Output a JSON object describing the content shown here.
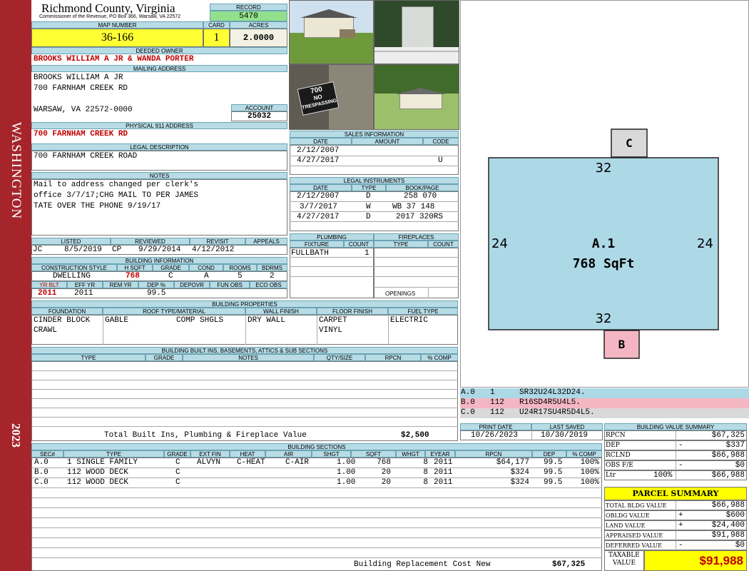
{
  "sidebar": {
    "district": "WASHINGTON",
    "year": "2023"
  },
  "header": {
    "county": "Richmond County, Virginia",
    "commissioner": "Commissioner of the Revenue, PO Box 366, Warsaw, VA 22572",
    "record_label": "RECORD",
    "record": "5470",
    "map_label": "MAP NUMBER",
    "map": "36-166",
    "card_label": "CARD",
    "card": "1",
    "acres_label": "ACRES",
    "acres": "2.0000"
  },
  "owner": {
    "deeded_label": "DEEDED OWNER",
    "deeded": "BROOKS WILLIAM A JR & WANDA PORTER",
    "mailing_label": "MAILING ADDRESS",
    "mail1": "BROOKS WILLIAM A JR",
    "mail2": "700 FARNHAM CREEK RD",
    "mail3": "WARSAW, VA 22572-0000",
    "account_label": "ACCOUNT",
    "account": "25032",
    "physical_label": "PHYSICAL 911 ADDRESS",
    "physical": "700 FARNHAM CREEK RD",
    "legal_label": "LEGAL DESCRIPTION",
    "legal": "700 FARNHAM CREEK ROAD",
    "notes_label": "NOTES",
    "notes1": "Mail to address changed per clerk's",
    "notes2": "office 3/7/17;CHG MAIL TO PER JAMES",
    "notes3": "TATE OVER THE PHONE 9/19/17"
  },
  "sales": {
    "label": "SALES INFORMATION",
    "cols": [
      "DATE",
      "AMOUNT",
      "CODE"
    ],
    "rows": [
      {
        "date": "2/12/2007",
        "amount": "",
        "code": ""
      },
      {
        "date": "4/27/2017",
        "amount": "",
        "code": "U"
      }
    ]
  },
  "legal_instruments": {
    "label": "LEGAL INSTRUMENTS",
    "cols": [
      "DATE",
      "TYPE",
      "BOOK/PAGE"
    ],
    "rows": [
      {
        "date": "2/12/2007",
        "type": "D",
        "book": "258 070"
      },
      {
        "date": "3/7/2017",
        "type": "W",
        "book": "WB 37 148"
      },
      {
        "date": "4/27/2017",
        "type": "D",
        "book": "2017 320RS"
      }
    ]
  },
  "review": {
    "listed_label": "LISTED",
    "reviewed_label": "REVIEWED",
    "revisit_label": "REVISIT",
    "appeals_label": "APPEALS",
    "listed_by": "JC",
    "listed": "8/5/2019",
    "reviewed_by": "CP",
    "reviewed": "9/29/2014",
    "revisit": "4/12/2012"
  },
  "building_info": {
    "label": "BUILDING INFORMATION",
    "c1": "CONSTRUCTION STYLE",
    "c2": "H SQFT",
    "c3": "GRADE",
    "c4": "COND",
    "c5": "ROOMS",
    "c6": "BDRMS",
    "style": "DWELLING",
    "hsqft": "768",
    "grade": "C",
    "cond": "A",
    "rooms": "5",
    "bdrms": "2",
    "c7": "YR BLT",
    "c8": "EFF YR",
    "c9": "REM YR",
    "c10": "DEP %",
    "c11": "DEPOVR",
    "c12": "FUN OBS",
    "c13": "ECO OBS",
    "yrblt": "2011",
    "effyr": "2011",
    "dep": "99.5"
  },
  "plumbing": {
    "label": "PLUMBING",
    "fixture_label": "FIXTURE",
    "count_label": "COUNT",
    "fixture": "FULLBATH",
    "count": "1"
  },
  "fireplaces": {
    "label": "FIREPLACES",
    "type_label": "TYPE",
    "count_label": "COUNT",
    "openings_label": "OPENINGS"
  },
  "properties": {
    "label": "BUILDING PROPERTIES",
    "foundation_label": "FOUNDATION",
    "roof_label": "ROOF TYPE/MATERIAL",
    "wall_label": "WALL FINISH",
    "floor_label": "FLOOR FINISH",
    "fuel_label": "FUEL TYPE",
    "foundation1": "CINDER BLOCK",
    "foundation2": "CRAWL",
    "roof_type": "GABLE",
    "roof_mat": "COMP SHGLS",
    "wall": "DRY WALL",
    "floor1": "CARPET",
    "floor2": "VINYL",
    "fuel": "ELECTRIC"
  },
  "builtins": {
    "label": "BUILDING BUILT INS, BASEMENTS, ATTICS & SUB SECTIONS",
    "cols": [
      "TYPE",
      "GRADE",
      "NOTES",
      "QTY/SIZE",
      "RPCN",
      "% COMP"
    ],
    "total_label": "Total Built Ins, Plumbing & Fireplace Value",
    "total": "$2,500"
  },
  "dates": {
    "print_label": "PRINT DATE",
    "saved_label": "LAST SAVED",
    "print": "10/26/2023",
    "saved": "10/30/2019"
  },
  "sections": {
    "label": "BUILDING SECTIONS",
    "cols": [
      "SEC#",
      "TYPE",
      "GRADE",
      "EXT FIN",
      "HEAT",
      "AIR",
      "SHGT",
      "SQFT",
      "WHGT",
      "EYEAR",
      "RPCN",
      "DEP",
      "% COMP"
    ],
    "rows": [
      {
        "sec": "A.0",
        "type": "1 SINGLE FAMILY",
        "grade": "C",
        "ext": "ALVYN",
        "heat": "C-HEAT",
        "air": "C-AIR",
        "shgt": "1.00",
        "sqft": "768",
        "whgt": "8",
        "eyear": "2011",
        "rpcn": "$64,177",
        "dep": "99.5",
        "comp": "100%"
      },
      {
        "sec": "B.0",
        "type": "112 WOOD DECK",
        "grade": "C",
        "ext": "",
        "heat": "",
        "air": "",
        "shgt": "1.00",
        "sqft": "20",
        "whgt": "8",
        "eyear": "2011",
        "rpcn": "$324",
        "dep": "99.5",
        "comp": "100%"
      },
      {
        "sec": "C.0",
        "type": "112 WOOD DECK",
        "grade": "C",
        "ext": "",
        "heat": "",
        "air": "",
        "shgt": "1.00",
        "sqft": "20",
        "whgt": "8",
        "eyear": "2011",
        "rpcn": "$324",
        "dep": "99.5",
        "comp": "100%"
      }
    ],
    "replacement_label": "Building Replacement Cost New",
    "replacement": "$67,325"
  },
  "sketch": {
    "main_label": "A.1",
    "main_area": "768 SqFt",
    "top": "32",
    "bottom": "32",
    "left": "24",
    "right": "24",
    "c": "C",
    "b": "B",
    "main_fill": "#add8e6",
    "c_fill": "#d9d9d9",
    "b_fill": "#f4b6c2",
    "vectors": [
      {
        "sec": "A.0",
        "code": "1",
        "vec": "SR32U24L32D24.",
        "color": "#add8e6"
      },
      {
        "sec": "B.0",
        "code": "112",
        "vec": "R16SD4R5U4L5.",
        "color": "#f4b6c2"
      },
      {
        "sec": "C.0",
        "code": "112",
        "vec": "U24R17SU4R5D4L5.",
        "color": "#d9d9d9"
      }
    ]
  },
  "value_summary": {
    "label": "BUILDING VALUE SUMMARY",
    "rows": [
      {
        "k": "RPCN",
        "s": "",
        "v": "$67,325"
      },
      {
        "k": "DEP",
        "s": "-",
        "v": "$337"
      },
      {
        "k": "RCLND",
        "s": "",
        "v": "$66,988"
      },
      {
        "k": "OBS F/E",
        "s": "-",
        "v": "$0"
      },
      {
        "k": "Ltr",
        "s": "100%",
        "v": "$66,988"
      }
    ]
  },
  "parcel": {
    "label": "PARCEL SUMMARY",
    "rows": [
      {
        "k": "TOTAL BLDG VALUE",
        "s": "",
        "v": "$66,988"
      },
      {
        "k": "OBLDG VALUE",
        "s": "+",
        "v": "$600"
      },
      {
        "k": "LAND VALUE",
        "s": "+",
        "v": "$24,400"
      },
      {
        "k": "APPRAISED VALUE",
        "s": "",
        "v": "$91,988"
      },
      {
        "k": "DEFERRED VALUE",
        "s": "-",
        "v": "$0"
      }
    ],
    "taxable_label1": "TAXABLE",
    "taxable_label2": "VALUE",
    "taxable": "$91,988",
    "accent": "#ffff00"
  },
  "photo_sign": {
    "n": "700",
    "a": "NO",
    "b": "TRESPASSING"
  }
}
